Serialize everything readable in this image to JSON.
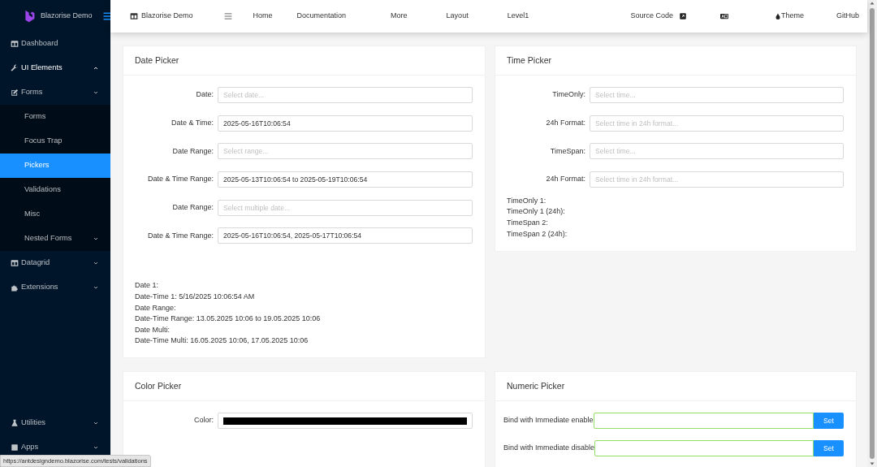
{
  "sidebar": {
    "logo_text": "Blazorise Demo",
    "items": [
      {
        "label": "Dashboard",
        "selected": false
      },
      {
        "label": "UI Elements",
        "selected": false,
        "expanded": true,
        "children": [
          {
            "label": "Forms",
            "selected": false,
            "expanded": false,
            "children": [
              {
                "label": "Forms",
                "selected": false
              },
              {
                "label": "Focus Trap",
                "selected": false
              },
              {
                "label": "Pickers",
                "selected": true
              },
              {
                "label": "Validations",
                "selected": false
              },
              {
                "label": "Misc",
                "selected": false
              },
              {
                "label": "Nested Forms",
                "selected": false,
                "expanded": false
              }
            ]
          }
        ]
      },
      {
        "label": "Datagrid",
        "selected": false,
        "expanded": false
      },
      {
        "label": "Extensions",
        "selected": false,
        "expanded": false
      }
    ],
    "bottom_items": [
      {
        "label": "Utilities",
        "selected": false,
        "expanded": false
      },
      {
        "label": "Apps",
        "selected": false,
        "expanded": false
      }
    ]
  },
  "topbar": {
    "brand": "Blazorise Demo",
    "links": [
      "Home",
      "Documentation",
      "More",
      "Layout",
      "Level1"
    ],
    "source_code": "Source Code",
    "theme": "Theme",
    "github": "GitHub"
  },
  "date_picker": {
    "title": "Date Picker",
    "fields": [
      {
        "label": "Date:",
        "placeholder": "Select date..."
      },
      {
        "label": "Date & Time:",
        "value": "2025-05-16T10:06:54"
      },
      {
        "label": "Date Range:",
        "placeholder": "Select range..."
      },
      {
        "label": "Date & Time Range:",
        "value": "2025-05-13T10:06:54 to 2025-05-19T10:06:54"
      },
      {
        "label": "Date Range:",
        "placeholder": "Select multiple date..."
      },
      {
        "label": "Date & Time Range:",
        "value": "2025-05-16T10:06:54, 2025-05-17T10:06:54"
      }
    ],
    "results": [
      "Date 1:",
      "Date-Time 1: 5/16/2025 10:06:54 AM",
      "Date Range:",
      "Date-Time Range: 13.05.2025 10:06 to 19.05.2025 10:06",
      "Date Multi:",
      "Date-Time Multi: 16.05.2025 10:06, 17.05.2025 10:06"
    ]
  },
  "time_picker": {
    "title": "Time Picker",
    "fields": [
      {
        "label": "TimeOnly:",
        "placeholder": "Select time..."
      },
      {
        "label": "24h Format:",
        "placeholder": "Select time in 24h format..."
      },
      {
        "label": "TimeSpan:",
        "placeholder": "Select time..."
      },
      {
        "label": "24h Format:",
        "placeholder": "Select time in 24h format..."
      }
    ],
    "results": [
      "TimeOnly 1:",
      "TimeOnly 1 (24h):",
      "TimeSpan 2:",
      "TimeSpan 2 (24h):"
    ]
  },
  "color_picker": {
    "title": "Color Picker",
    "label": "Color:",
    "color": "#000000"
  },
  "numeric_picker": {
    "title": "Numeric Picker",
    "rows": [
      {
        "label": "Bind with Immediate enable",
        "valid": true,
        "button": "Set"
      },
      {
        "label": "Bind with Immediate disable",
        "valid": true,
        "button": "Set"
      }
    ]
  },
  "status_bar": {
    "url": "https://antdesigndemo.blazorise.com/tests/validations"
  }
}
